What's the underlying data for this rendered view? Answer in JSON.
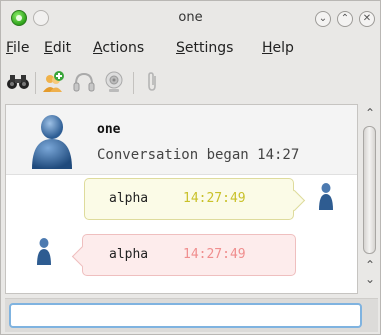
{
  "window": {
    "title": "one"
  },
  "menu": {
    "items": [
      {
        "label": "File"
      },
      {
        "label": "Edit"
      },
      {
        "label": "Actions"
      },
      {
        "label": "Settings"
      },
      {
        "label": "Help"
      }
    ]
  },
  "toolbar": {
    "icons": [
      "binoculars-icon",
      "add-contact-icon",
      "headset-icon",
      "webcam-icon",
      "paperclip-icon"
    ]
  },
  "conversation": {
    "contact_name": "one",
    "began_text": "Conversation began 14:27",
    "messages": [
      {
        "direction": "outgoing",
        "text": "alpha",
        "time": "14:27:49"
      },
      {
        "direction": "incoming",
        "text": "alpha",
        "time": "14:27:49"
      }
    ]
  },
  "composer": {
    "value": "",
    "placeholder": ""
  },
  "colors": {
    "outgoing_bubble": "#fbfbe7",
    "outgoing_time": "#c9c12a",
    "incoming_bubble": "#fdecec",
    "incoming_time": "#f08e8e",
    "focus_border": "#7fb3e0"
  }
}
